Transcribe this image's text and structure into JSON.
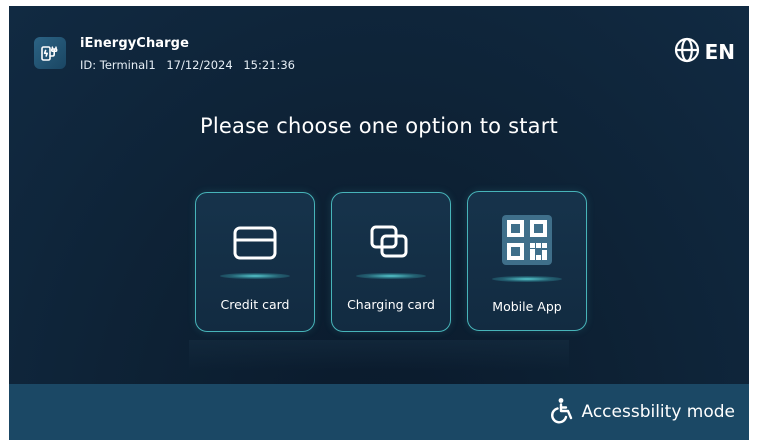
{
  "header": {
    "app_name": "iEnergyCharge",
    "terminal_id": "ID: Terminal1",
    "date": "17/12/2024",
    "time": "15:21:36",
    "language": "EN",
    "logo_icon": "ev-charger-icon",
    "language_icon": "globe-icon"
  },
  "main": {
    "title": "Please choose one option to start",
    "options": [
      {
        "label": "Credit card",
        "icon": "credit-card-icon"
      },
      {
        "label": "Charging card",
        "icon": "charging-card-icon"
      },
      {
        "label": "Mobile App",
        "icon": "qr-code-icon"
      }
    ]
  },
  "footer": {
    "accessibility_label": "Accessbility mode",
    "accessibility_icon": "wheelchair-icon"
  },
  "colors": {
    "background": "#0e2236",
    "accent": "#47b4b9",
    "footer": "#1b4865",
    "text": "#ffffff"
  }
}
